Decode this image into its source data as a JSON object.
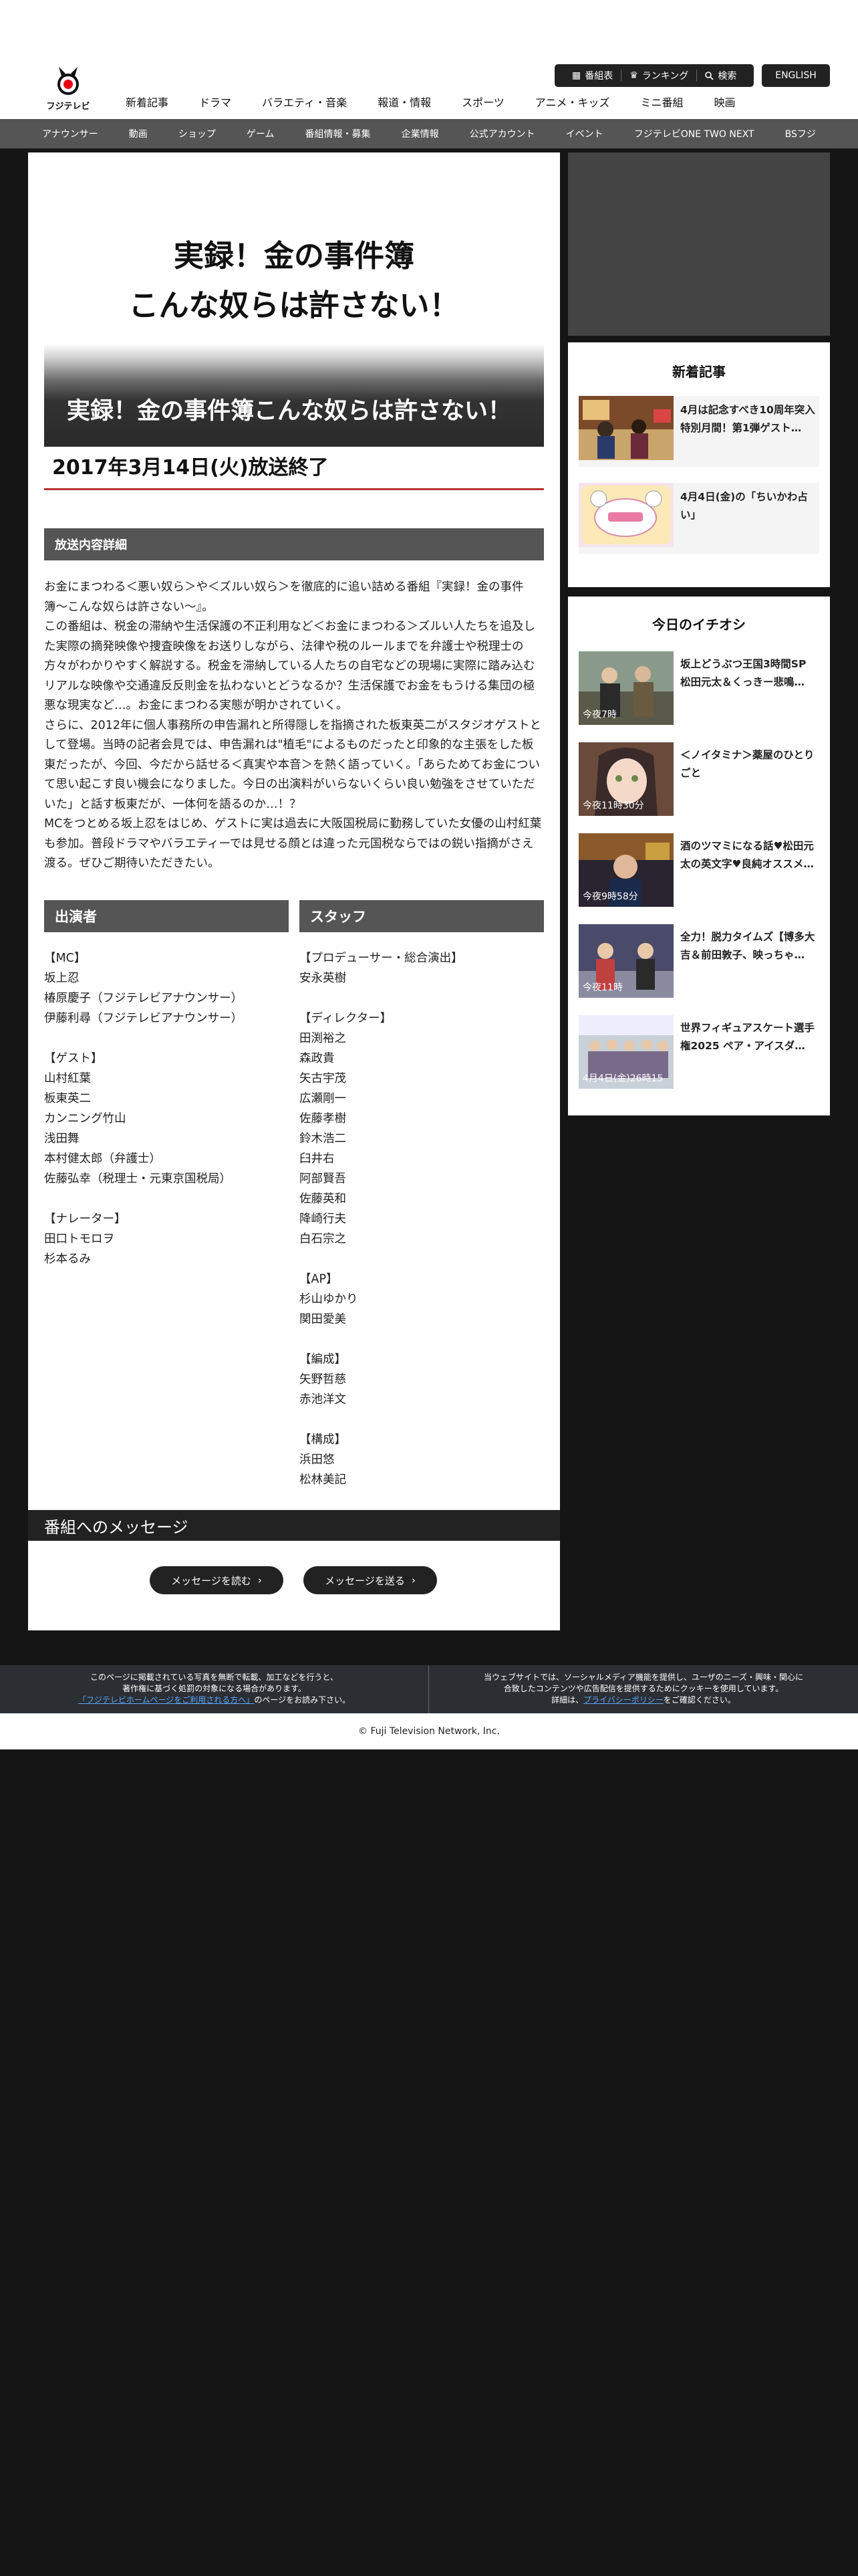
{
  "header": {
    "logo_text": "フジテレビ",
    "top_buttons": [
      "番組表",
      "ランキング",
      "検索"
    ],
    "english_label": "ENGLISH",
    "main_nav": [
      "新着記事",
      "ドラマ",
      "バラエティ・音楽",
      "報道・情報",
      "スポーツ",
      "アニメ・キッズ",
      "ミニ番組",
      "映画"
    ],
    "sub_nav": [
      "アナウンサー",
      "動画",
      "ショップ",
      "ゲーム",
      "番組情報・募集",
      "企業情報",
      "公式アカウント",
      "イベント",
      "フジテレビONE TWO NEXT",
      "BSフジ"
    ]
  },
  "program": {
    "hero_title_line1": "実録！金の事件簿",
    "hero_title_line2": "こんな奴らは許さない！",
    "banner_title": "実録！金の事件簿こんな奴らは許さない！",
    "end_date": "2017年3月14日(火)放送終了",
    "detail_heading": "放送内容詳細",
    "description": [
      "お金にまつわる＜悪い奴ら＞や＜ズルい奴ら＞を徹底的に追い詰める番組『実録！金の事件簿〜こんな奴らは許さない〜』。",
      "この番組は、税金の滞納や生活保護の不正利用など＜お金にまつわる＞ズルい人たちを追及した実際の摘発映像や捜査映像をお送りしながら、法律や税のルールまでを弁護士や税理士の方々がわかりやすく解説する。税金を滞納している人たちの自宅などの現場に実際に踏み込むリアルな映像や交通違反反則金を払わないとどうなるか？生活保護でお金をもうける集団の極悪な現実など…。お金にまつわる実態が明かされていく。",
      "さらに、2012年に個人事務所の申告漏れと所得隠しを指摘された板東英二がスタジオゲストとして登場。当時の記者会見では、申告漏れは\"植毛\"によるものだったと印象的な主張をした板東だったが、今回、今だから話せる＜真実や本音＞を熱く語っていく。「あらためてお金について思い起こす良い機会になりました。今日の出演料がいらないくらい良い勉強をさせていただいた」と話す板東だが、一体何を語るのか…！？",
      "MCをつとめる坂上忍をはじめ、ゲストに実は過去に大阪国税局に勤務していた女優の山村紅葉も参加。普段ドラマやバラエティーでは見せる顔とは違った元国税ならではの鋭い指摘がさえ渡る。ぜひご期待いただきたい。"
    ],
    "cast_heading": "出演者",
    "cast": [
      "【MC】",
      "坂上忍",
      "椿原慶子（フジテレビアナウンサー）",
      "伊藤利尋（フジテレビアナウンサー）",
      "",
      "【ゲスト】",
      "山村紅葉",
      "板東英二",
      "カンニング竹山",
      "浅田舞",
      "本村健太郎（弁護士）",
      "佐藤弘幸（税理士・元東京国税局）",
      "",
      "【ナレーター】",
      "田口トモロヲ",
      "杉本るみ"
    ],
    "staff_heading": "スタッフ",
    "staff": [
      "【プロデューサー・総合演出】",
      "安永英樹",
      "",
      "【ディレクター】",
      "田渕裕之",
      "森政貴",
      "矢古宇茂",
      "広瀬剛一",
      "佐藤孝樹",
      "鈴木浩二",
      "臼井右",
      "阿部賢吾",
      "佐藤英和",
      "降崎行夫",
      "白石宗之",
      "",
      "【AP】",
      "杉山ゆかり",
      "関田愛美",
      "",
      "【編成】",
      "矢野哲慈",
      "赤池洋文",
      "",
      "【構成】",
      "浜田悠",
      "松林美記"
    ],
    "message_heading": "番組へのメッセージ",
    "read_message": "メッセージを読む",
    "send_message": "メッセージを送る"
  },
  "sidebar": {
    "new_articles_heading": "新着記事",
    "new_articles": [
      {
        "title": "4月は記念すべき10周年突入特別月間！第1弾ゲスト…"
      },
      {
        "title": "4月4日(金)の「ちいかわ占い」"
      }
    ],
    "pickup_heading": "今日のイチオシ",
    "pickups": [
      {
        "title": "坂上どうぶつ王国3時間SP 松田元太＆くっきー悲鳴…",
        "time": "今夜7時"
      },
      {
        "title": "＜ノイタミナ＞薬屋のひとりごと",
        "time": "今夜11時30分"
      },
      {
        "title": "酒のツマミになる話♥松田元太の英文字♥良純オススメ…",
        "time": "今夜9時58分"
      },
      {
        "title": "全力！脱力タイムズ【博多大吉＆前田敦子、映っちゃ…",
        "time": "今夜11時"
      },
      {
        "title": "世界フィギュアスケート選手権2025 ペア・アイスダ…",
        "time": "4月4日(金)26時15"
      }
    ]
  },
  "footer": {
    "left_line1": "このページに掲載されている写真を無断で転載、加工などを行うと、",
    "left_line2": "著作権に基づく処罰の対象になる場合があります。",
    "left_link": "「フジテレビホームページをご利用される方へ」",
    "left_line3_suffix": "のページをお読み下さい。",
    "right_line1": "当ウェブサイトでは、ソーシャルメディア機能を提供し、ユーザのニーズ・興味・関心に",
    "right_line2": "合致したコンテンツや広告配信を提供するためにクッキーを使用しています。",
    "right_prefix": "詳細は、",
    "right_link": "プライバシーポリシー",
    "right_suffix": "をご確認ください。",
    "copyright": "© Fuji Television Network, Inc."
  },
  "colors": {
    "accent_red": "#b8312f",
    "dark": "#222222",
    "section_gray": "#555555",
    "background": "#151515"
  }
}
